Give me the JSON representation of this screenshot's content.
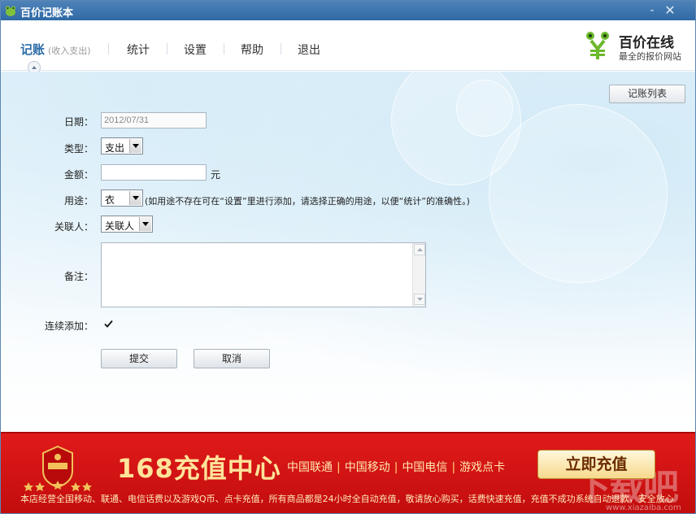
{
  "window": {
    "title": "百价记账本",
    "minimize_label": "-",
    "close_label": "✕"
  },
  "nav": {
    "items": [
      {
        "label": "记账",
        "sub": "(收入支出)"
      },
      {
        "label": "统计"
      },
      {
        "label": "设置"
      },
      {
        "label": "帮助"
      },
      {
        "label": "退出"
      }
    ],
    "active": 0
  },
  "brand": {
    "name": "百价在线",
    "slogan": "最全的报价网站"
  },
  "toolbar": {
    "list_button": "记账列表"
  },
  "form": {
    "date": {
      "label": "日期：",
      "value": "2012/07/31"
    },
    "type": {
      "label": "类型：",
      "selected": "支出"
    },
    "amount": {
      "label": "金额：",
      "value": "",
      "unit": "元"
    },
    "purpose": {
      "label": "用途：",
      "selected": "衣",
      "hint": "(如用途不存在可在“设置”里进行添加，请选择正确的用途，以便“统计”的准确性。)"
    },
    "related": {
      "label": "关联人：",
      "selected": "关联人"
    },
    "notes": {
      "label": "备注：",
      "value": ""
    },
    "continuous": {
      "label": "连续添加：",
      "checked": true
    },
    "submit_label": "提交",
    "cancel_label": "取消"
  },
  "banner": {
    "title": "168充值中心",
    "carriers": [
      "中国联通",
      "中国移动",
      "中国电信",
      "游戏点卡"
    ],
    "button": "立即充值",
    "description": "本店经营全国移动、联通、电信话费以及游戏Q币、点卡充值，所有商品都是24小时全自动充值，敬请放心购买，话费快速充值，充值不成功系统自动退款，安全放心",
    "watermark": "下载吧",
    "watermark_sub": "www.xiazaiba.com"
  },
  "colors": {
    "accent": "#2d6ca8",
    "titlebar": "#3a73ad",
    "banner_red": "#d41414",
    "banner_gold": "#ffe39a"
  }
}
